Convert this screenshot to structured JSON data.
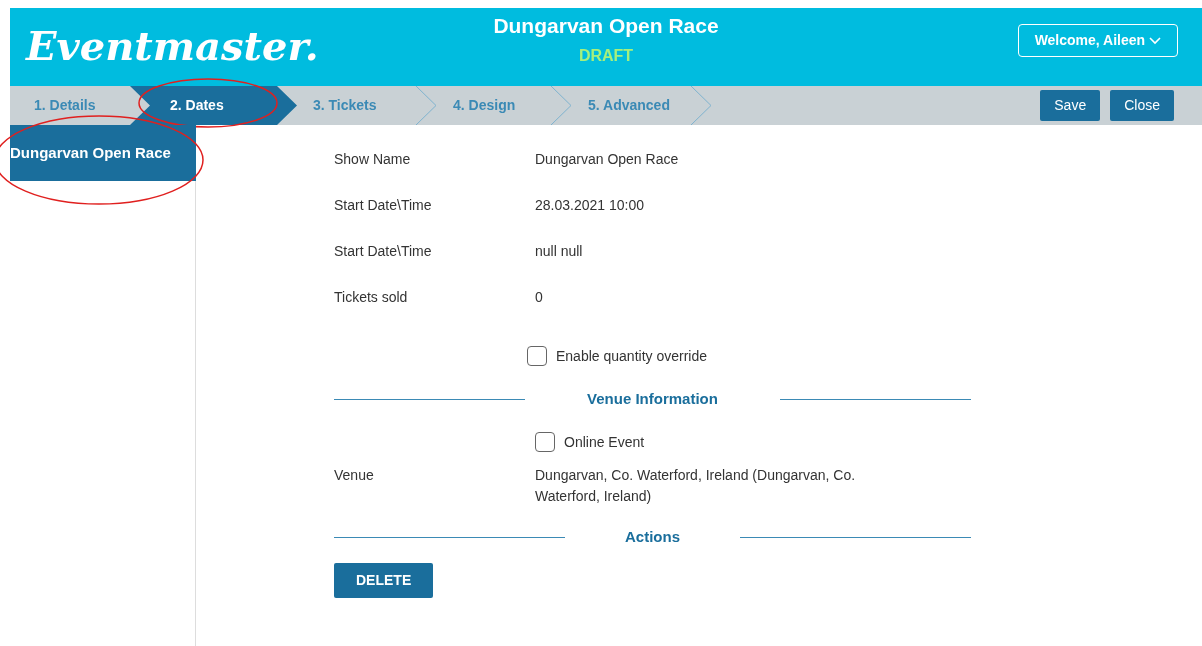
{
  "header": {
    "logo": "Eventmaster.",
    "title": "Dungarvan Open Race",
    "status": "DRAFT",
    "user_menu": "Welcome, Aileen"
  },
  "steps": [
    {
      "label": "1. Details",
      "selected": false,
      "highlighted": false
    },
    {
      "label": "2. Dates",
      "selected": true,
      "highlighted": true
    },
    {
      "label": "3. Tickets",
      "selected": false,
      "highlighted": false
    },
    {
      "label": "4. Design",
      "selected": false,
      "highlighted": false
    },
    {
      "label": "5. Advanced",
      "selected": false,
      "highlighted": false
    }
  ],
  "toolbar_buttons": [
    "Save",
    "Close"
  ],
  "sidebar": {
    "items": [
      {
        "label": "Dungarvan Open Race",
        "selected": true,
        "highlighted": true
      }
    ]
  },
  "sections": [
    {
      "kind": "fields",
      "rows": [
        {
          "label": "Show Name",
          "value": "Dungarvan Open Race"
        },
        {
          "label": "Start Date\\Time",
          "value": "28.03.2021 10:00"
        },
        {
          "label": "Start Date\\Time",
          "value": "null null"
        },
        {
          "label": "Tickets sold",
          "value": "0"
        }
      ],
      "checkbox": {
        "label": "Enable quantity override",
        "checked": false
      }
    },
    {
      "kind": "venue",
      "heading": "Venue Information",
      "checkbox": {
        "label": "Online Event",
        "checked": false
      },
      "rows": [
        {
          "label": "Venue",
          "value": "Dungarvan, Co. Waterford, Ireland (Dungarvan, Co. Waterford, Ireland)"
        }
      ]
    },
    {
      "kind": "actions",
      "heading": "Actions",
      "button": "DELETE"
    }
  ]
}
